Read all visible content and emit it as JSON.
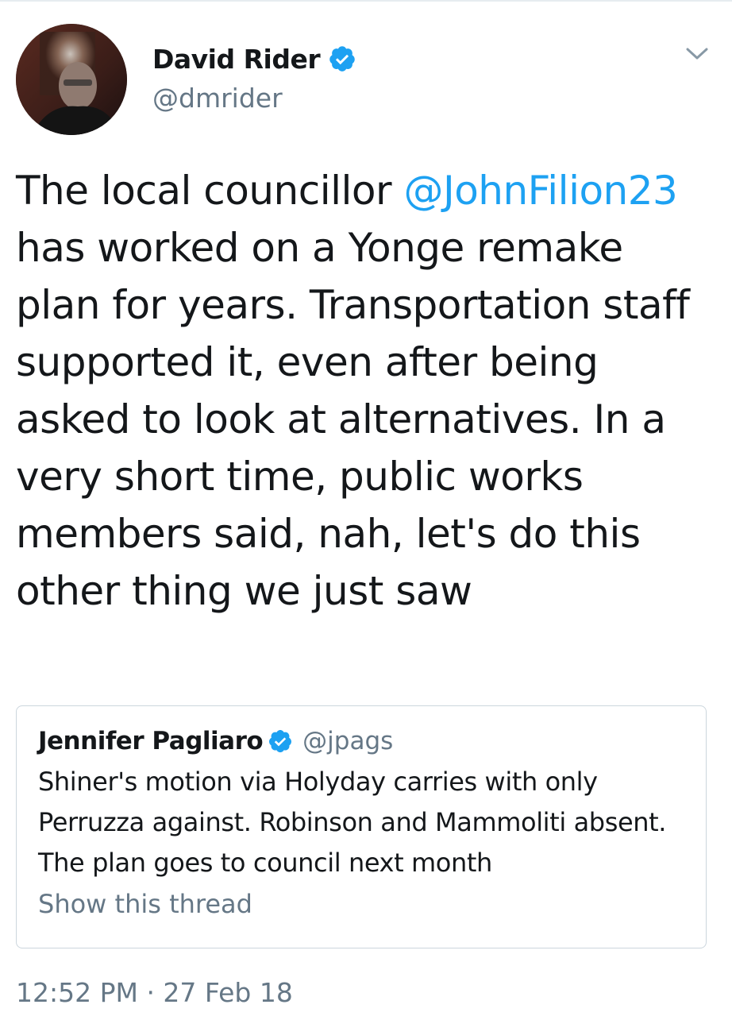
{
  "author": {
    "display_name": "David Rider",
    "handle": "@dmrider",
    "verified": true
  },
  "tweet": {
    "text_before": "The local councillor ",
    "mention": "@JohnFilion23",
    "text_after": " has worked on a Yonge remake plan for years. Transportation staff supported it, even after being asked to look at alternatives. In a very short time, public works members said, nah, let's do this other thing we just saw",
    "timestamp": "12:52 PM · 27 Feb 18"
  },
  "quoted_tweet": {
    "display_name": "Jennifer Pagliaro",
    "handle": "@jpags",
    "verified": true,
    "text": "Shiner's motion via Holyday carries with only Perruzza against. Robinson and Mammoliti absent. The plan goes to council next month",
    "thread_link": "Show this thread"
  },
  "icons": {
    "verified": "verified-badge-icon",
    "menu": "chevron-down-icon"
  },
  "colors": {
    "link": "#1da1f2",
    "secondary_text": "#657786",
    "primary_text": "#14171a",
    "border": "#ccd6dd"
  }
}
